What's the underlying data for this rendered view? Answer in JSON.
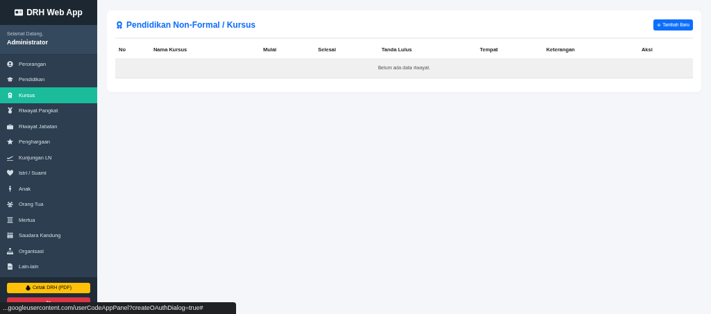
{
  "sidebar": {
    "brand": "DRH Web App",
    "greeting": "Selamat Datang,",
    "user": "Administrator",
    "items": [
      {
        "label": "Perorangan",
        "selected": false
      },
      {
        "label": "Pendidikan",
        "selected": false
      },
      {
        "label": "Kursus",
        "selected": true
      },
      {
        "label": "Riwayat Pangkat",
        "selected": false
      },
      {
        "label": "Riwayat Jabatan",
        "selected": false
      },
      {
        "label": "Penghargaan",
        "selected": false
      },
      {
        "label": "Kunjungan LN",
        "selected": false
      },
      {
        "label": "Istri / Suami",
        "selected": false
      },
      {
        "label": "Anak",
        "selected": false
      },
      {
        "label": "Orang Tua",
        "selected": false
      },
      {
        "label": "Mertua",
        "selected": false
      },
      {
        "label": "Saudara Kandung",
        "selected": false
      },
      {
        "label": "Organisasi",
        "selected": false
      },
      {
        "label": "Lain-lain",
        "selected": false
      }
    ],
    "buttons": [
      {
        "label": "Cetak DRH (PDF)",
        "kind": "print"
      },
      {
        "kind": "logout"
      }
    ]
  },
  "main": {
    "title": "Pendidikan Non-Formal / Kursus",
    "add_button": "Tambah Baru",
    "table": {
      "columns": [
        "No",
        "Nama Kursus",
        "Mulai",
        "Selesai",
        "Tanda Lulus",
        "Tempat",
        "Keterangan",
        "Aksi"
      ],
      "empty_message": "Belum ada data riwayat."
    }
  },
  "status_bar": "...googleusercontent.com/userCodeAppPanel?createOAuthDialog=true#"
}
